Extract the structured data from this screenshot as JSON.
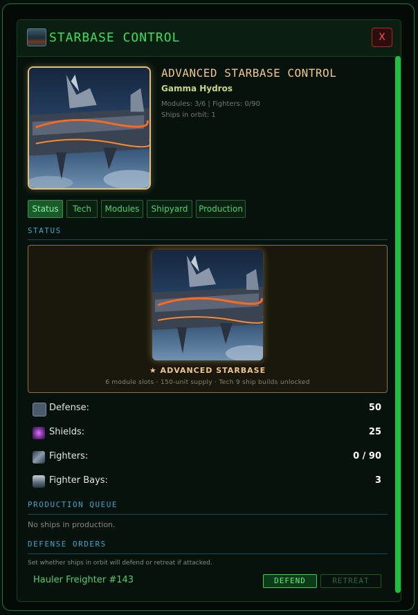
{
  "window": {
    "title": "STARBASE CONTROL",
    "close_label": "X"
  },
  "header": {
    "name": "ADVANCED STARBASE CONTROL",
    "system": "Gamma Hydros",
    "modules_line": "Modules: 3/6 | Fighters: 0/90",
    "orbit_line": "Ships in orbit: 1"
  },
  "tabs": [
    "Status",
    "Tech",
    "Modules",
    "Shipyard",
    "Production"
  ],
  "status": {
    "section_title": "STATUS",
    "card_label": "★ ADVANCED STARBASE",
    "card_sub": "6 module slots · 150-unit supply · Tech 9 ship builds unlocked",
    "stats": [
      {
        "label": "Defense:",
        "value": "50",
        "icon": "defense-icon"
      },
      {
        "label": "Shields:",
        "value": "25",
        "icon": "shield-icon"
      },
      {
        "label": "Fighters:",
        "value": "0 / 90",
        "icon": "fighter-icon"
      },
      {
        "label": "Fighter Bays:",
        "value": "3",
        "icon": "fighter-bay-icon"
      }
    ]
  },
  "production": {
    "section_title": "PRODUCTION QUEUE",
    "empty_text": "No ships in production."
  },
  "defense_orders": {
    "section_title": "DEFENSE ORDERS",
    "description": "Set whether ships in orbit will defend or retreat if attacked.",
    "ship_name": "Hauler Freighter #143",
    "defend_label": "DEFEND",
    "retreat_label": "RETREAT"
  },
  "colors": {
    "accent_green": "#38e060",
    "gold": "#f0c888",
    "section_blue": "#3aa6d0",
    "danger_red": "#ff4b4b"
  }
}
